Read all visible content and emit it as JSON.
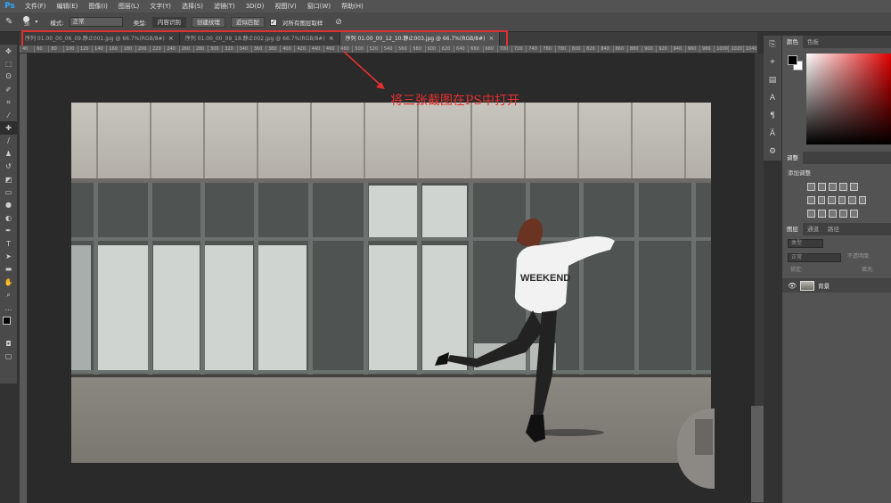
{
  "app": {
    "logo": "Ps"
  },
  "menu": [
    "文件(F)",
    "编辑(E)",
    "图像(I)",
    "图层(L)",
    "文字(Y)",
    "选择(S)",
    "滤镜(T)",
    "3D(D)",
    "视图(V)",
    "窗口(W)",
    "帮助(H)"
  ],
  "options": {
    "mode_label": "模式:",
    "mode_value": "正常",
    "type_label": "类型:",
    "btn_content": "内容识别",
    "btn_texture": "创建纹理",
    "btn_approx": "近似匹配",
    "sample_all": "对所有图层取样",
    "brush_size": "38"
  },
  "tabs": [
    {
      "label": "序列 01.00_00_06_09.静止001.jpg @ 66.7%(RGB/8#)",
      "close": "×",
      "active": false
    },
    {
      "label": "序列 01.00_00_09_18.静止002.jpg @ 66.7%(RGB/8#)",
      "close": "×",
      "active": false
    },
    {
      "label": "序列 01.00_00_12_10.静止003.jpg @ 66.7%(RGB/8#)",
      "close": "×",
      "active": true
    }
  ],
  "ruler_ticks": [
    "40",
    "60",
    "80",
    "100",
    "120",
    "140",
    "160",
    "180",
    "200",
    "220",
    "240",
    "260",
    "280",
    "300",
    "320",
    "340",
    "360",
    "380",
    "400",
    "420",
    "440",
    "460",
    "480",
    "500",
    "520",
    "540",
    "560",
    "580",
    "600",
    "620",
    "640",
    "660",
    "680",
    "700",
    "720",
    "740",
    "760",
    "780",
    "800",
    "820",
    "840",
    "860",
    "880",
    "900",
    "920",
    "940",
    "960",
    "980",
    "1000",
    "1020",
    "1040"
  ],
  "annotation": {
    "text": "将三张截图在PS中打开",
    "color": "#e53030"
  },
  "shirt_text": "WEEKEND",
  "panels": {
    "color_tabs": [
      "颜色",
      "色板"
    ],
    "adjust_title": "调整",
    "adjust_add": "添加调整",
    "layer_tabs": [
      "图层",
      "通道",
      "路径"
    ],
    "kind_placeholder": "类型",
    "blend_mode": "正常",
    "opacity_label": "不透明度:",
    "lock_label": "锁定:",
    "fill_label": "填充:",
    "layer_name": "背景"
  },
  "colors": {
    "accent": "#31a8ff",
    "highlight": "#e03030"
  }
}
